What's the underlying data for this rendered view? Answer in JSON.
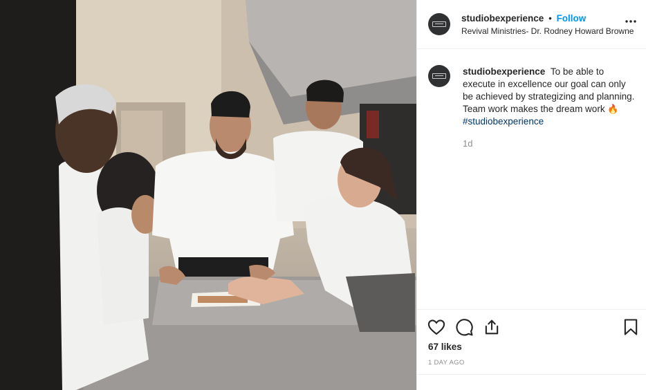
{
  "post": {
    "username": "studiobexperience",
    "dot": "•",
    "follow_label": "Follow",
    "location": "Revival Ministries- Dr. Rodney Howard Browne",
    "more_label": "•••",
    "photo_alt": "Culinary students in white chef coats gathered around a steel kitchen table"
  },
  "caption": {
    "username": "studiobexperience",
    "text": "To be able to execute in excellence our goal can only be achieved by strategizing and planning. Team work makes the dream work",
    "emoji": "🔥",
    "hashtag": "#studiobexperience",
    "time_ago": "1d"
  },
  "actions": {
    "icons": [
      "heart-icon",
      "comment-icon",
      "share-icon",
      "bookmark-icon"
    ],
    "likes": "67 likes",
    "date": "1 DAY AGO"
  }
}
